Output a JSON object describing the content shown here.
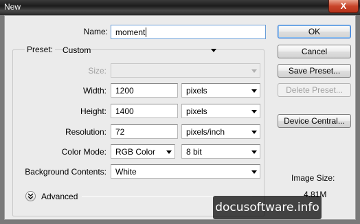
{
  "window": {
    "title": "New",
    "close_glyph": "X"
  },
  "form": {
    "name_label": "Name:",
    "name_value": "moment",
    "preset_label": "Preset:",
    "preset_value": "Custom",
    "size_label": "Size:",
    "size_value": "",
    "width_label": "Width:",
    "width_value": "1200",
    "width_unit": "pixels",
    "height_label": "Height:",
    "height_value": "1400",
    "height_unit": "pixels",
    "resolution_label": "Resolution:",
    "resolution_value": "72",
    "resolution_unit": "pixels/inch",
    "color_mode_label": "Color Mode:",
    "color_mode_value": "RGB Color",
    "bit_depth_value": "8 bit",
    "background_label": "Background Contents:",
    "background_value": "White",
    "advanced_label": "Advanced"
  },
  "buttons": {
    "ok": "OK",
    "cancel": "Cancel",
    "save_preset": "Save Preset...",
    "delete_preset": "Delete Preset...",
    "device_central": "Device Central..."
  },
  "image_size": {
    "label": "Image Size:",
    "value": "4.81M"
  },
  "watermark": "docusoftware.info",
  "colors": {
    "title_bar": "#2a2a2a",
    "close_button": "#c9452a",
    "dialog_bg": "#ebebeb",
    "default_button_border": "#3a7bd5"
  },
  "icons": {
    "advanced_toggle": "chevron-double-down-icon",
    "dropdown_arrow": "triangle-down-icon"
  }
}
